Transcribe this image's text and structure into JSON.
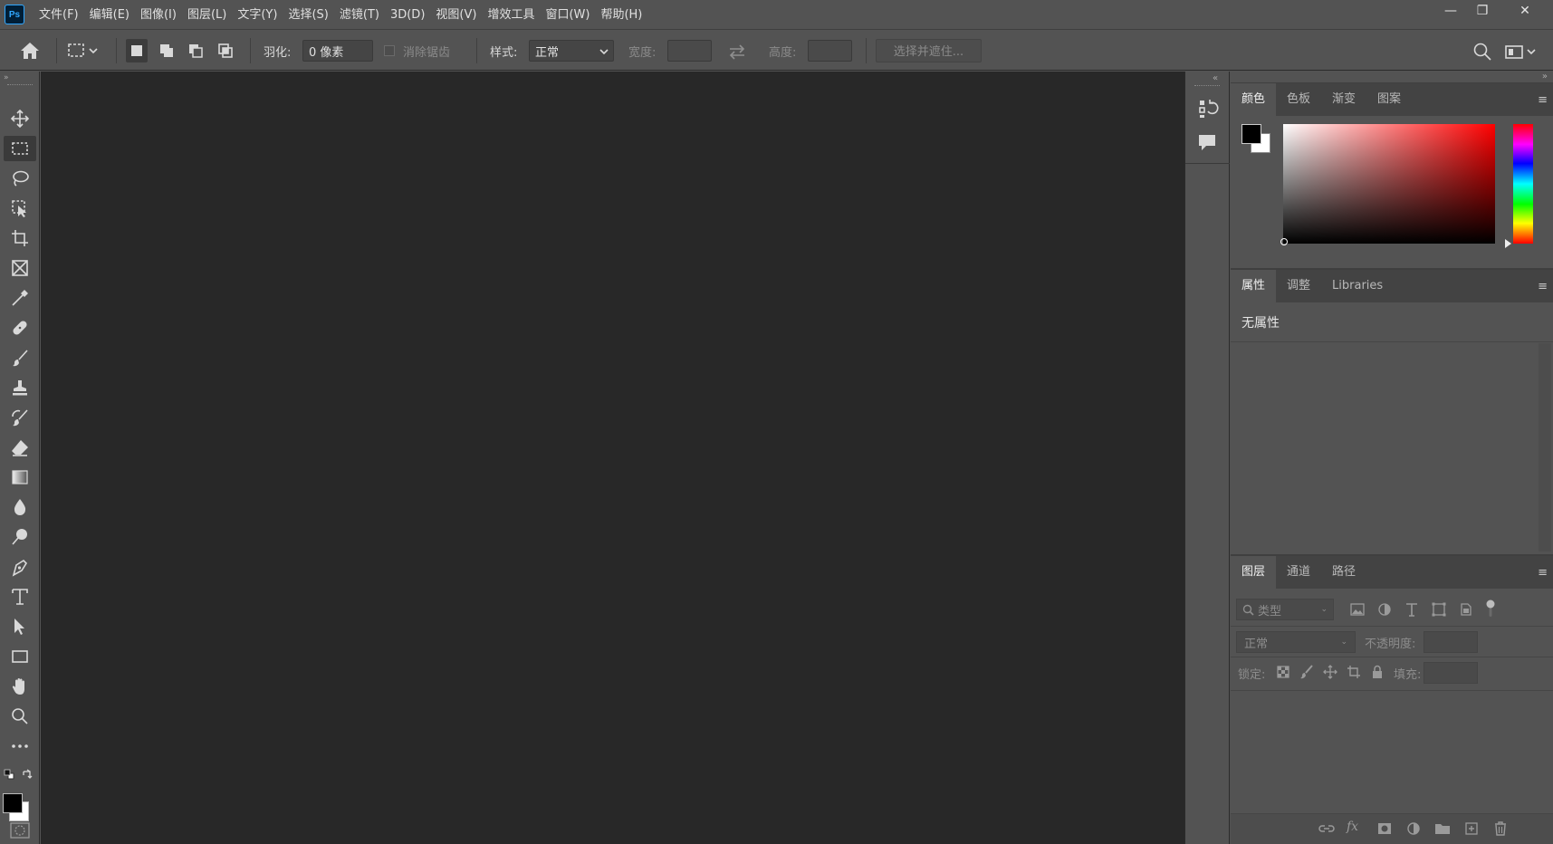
{
  "app": {
    "logo": "Ps"
  },
  "menu": [
    "文件(F)",
    "编辑(E)",
    "图像(I)",
    "图层(L)",
    "文字(Y)",
    "选择(S)",
    "滤镜(T)",
    "3D(D)",
    "视图(V)",
    "增效工具",
    "窗口(W)",
    "帮助(H)"
  ],
  "window_controls": {
    "minimize": "—",
    "restore": "❐",
    "close": "✕"
  },
  "options_bar": {
    "feather_label": "羽化:",
    "feather_value": "0 像素",
    "antialias_label": "消除锯齿",
    "style_label": "样式:",
    "style_value": "正常",
    "width_label": "宽度:",
    "height_label": "高度:",
    "select_mask_button": "选择并遮住..."
  },
  "color_panel": {
    "tabs": [
      "颜色",
      "色板",
      "渐变",
      "图案"
    ],
    "foreground": "#000000",
    "background": "#ffffff",
    "hue_color": "#ff0000"
  },
  "properties_panel": {
    "tabs": [
      "属性",
      "调整",
      "Libraries"
    ],
    "empty_text": "无属性"
  },
  "layers_panel": {
    "tabs": [
      "图层",
      "通道",
      "路径"
    ],
    "filter_placeholder": "类型",
    "blend_mode": "正常",
    "opacity_label": "不透明度:",
    "lock_label": "锁定:",
    "fill_label": "填充:",
    "fx_label": "fx"
  },
  "colors": {
    "canvas": "#282828",
    "ui": "#535353",
    "tab_bar": "#434343"
  }
}
